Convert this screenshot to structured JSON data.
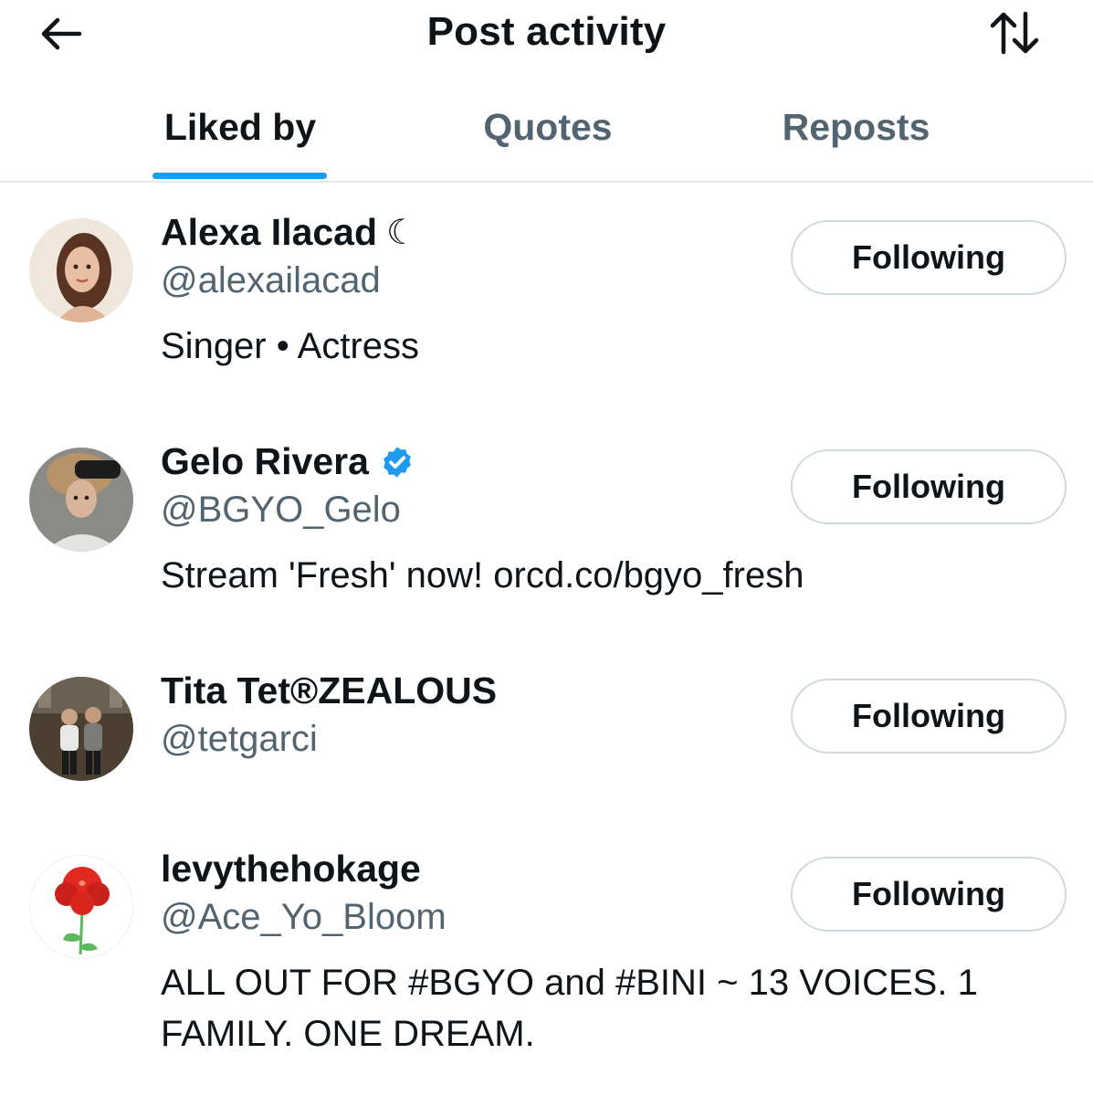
{
  "header": {
    "title": "Post activity",
    "back_icon": "arrow-left-icon",
    "sort_icon": "sort-arrows-icon"
  },
  "tabs": [
    {
      "label": "Liked by",
      "active": true
    },
    {
      "label": "Quotes",
      "active": false
    },
    {
      "label": "Reposts",
      "active": false
    }
  ],
  "users": [
    {
      "name": "Alexa Ilacad",
      "name_suffix": "☾",
      "verified": false,
      "handle": "@alexailacad",
      "bio": "Singer • Actress",
      "button_label": "Following"
    },
    {
      "name": "Gelo Rivera",
      "name_suffix": "",
      "verified": true,
      "handle": "@BGYO_Gelo",
      "bio": "Stream 'Fresh' now! orcd.co/bgyo_fresh",
      "button_label": "Following"
    },
    {
      "name": "Tita Tet®ZEALOUS",
      "name_suffix": "",
      "verified": false,
      "handle": "@tetgarci",
      "bio": "",
      "button_label": "Following"
    },
    {
      "name": "levythehokage",
      "name_suffix": "",
      "verified": false,
      "handle": "@Ace_Yo_Bloom",
      "bio": "ALL OUT FOR #BGYO and #BINI ~ 13 VOICES. 1 FAMILY. ONE DREAM.",
      "button_label": "Following"
    }
  ],
  "colors": {
    "accent": "#1d9bf0",
    "text_primary": "#0f1419",
    "text_secondary": "#536471",
    "border": "#cfd9de"
  }
}
